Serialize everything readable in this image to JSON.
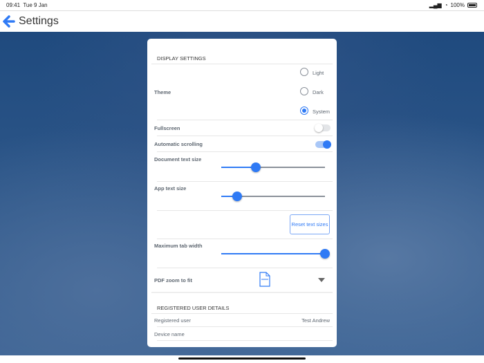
{
  "status": {
    "time": "09:41",
    "date": "Tue 9 Jan",
    "battery": "100%"
  },
  "nav": {
    "title": "Settings"
  },
  "display": {
    "header": "DISPLAY SETTINGS",
    "theme": {
      "label": "Theme",
      "options": [
        "Light",
        "Dark",
        "System"
      ],
      "selected": "System"
    },
    "fullscreen": {
      "label": "Fullscreen",
      "on": false
    },
    "autoscroll": {
      "label": "Automatic scrolling",
      "on": true
    },
    "doc_text": {
      "label": "Document text size",
      "value": 0.33
    },
    "app_text": {
      "label": "App text size",
      "value": 0.15
    },
    "reset": "Reset text sizes",
    "tab_width": {
      "label": "Maximum tab width",
      "value": 1.0
    },
    "pdf_zoom": {
      "label": "PDF zoom to fit"
    }
  },
  "user": {
    "header": "REGISTERED USER DETAILS",
    "registered_label": "Registered user",
    "registered_value": "Test Andrew",
    "device_label": "Device name"
  },
  "colors": {
    "accent": "#2f7af5"
  }
}
